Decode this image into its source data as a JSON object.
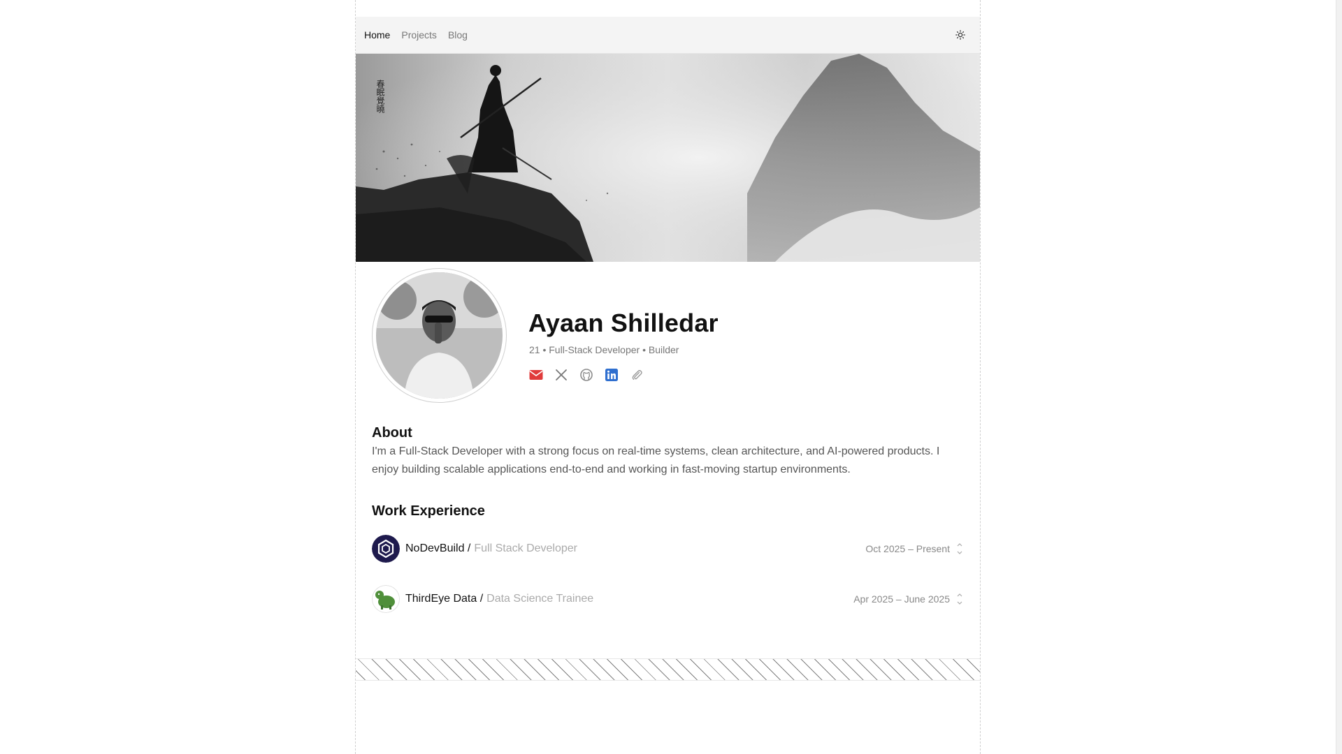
{
  "nav": {
    "links": [
      {
        "label": "Home",
        "active": true
      },
      {
        "label": "Projects",
        "active": false
      },
      {
        "label": "Blog",
        "active": false
      }
    ],
    "theme_icon": "sun-icon"
  },
  "banner": {
    "calligraphy": "春眠覺曉"
  },
  "profile": {
    "name": "Ayaan Shilledar",
    "tagline": "21 • Full-Stack Developer • Builder",
    "socials": [
      {
        "icon": "email-icon",
        "color": "#e03b3b"
      },
      {
        "icon": "x-icon",
        "color": "#777777"
      },
      {
        "icon": "github-icon",
        "color": "#8a8a8a"
      },
      {
        "icon": "linkedin-icon",
        "color": "#2f6fcf"
      },
      {
        "icon": "attachment-icon",
        "color": "#999999"
      }
    ]
  },
  "about": {
    "title": "About",
    "text": "I'm a Full-Stack Developer with a strong focus on real-time systems, clean architecture, and AI-powered products. I enjoy building scalable applications end-to-end and working in fast-moving startup environments."
  },
  "experience": {
    "title": "Work Experience",
    "items": [
      {
        "company": "NoDevBuild /",
        "role": "Full Stack Developer",
        "dates": "Oct 2025 – Present"
      },
      {
        "company": "ThirdEye Data /",
        "role": "Data Science Trainee",
        "dates": "Apr 2025 – June 2025"
      }
    ]
  }
}
